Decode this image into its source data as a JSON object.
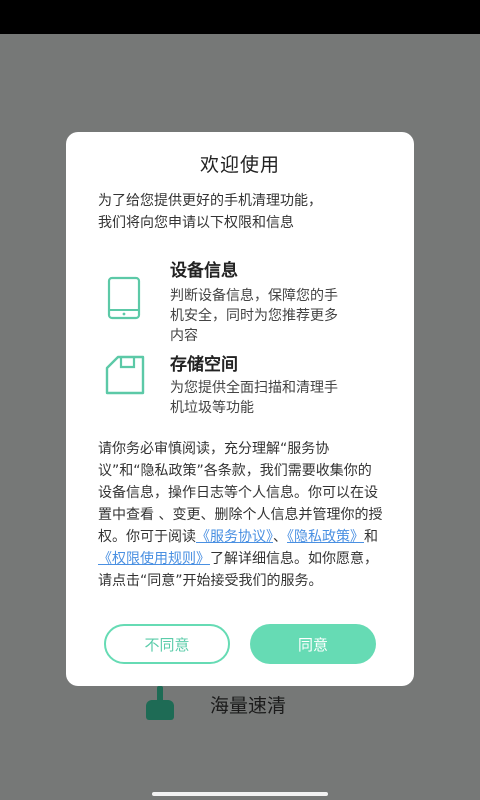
{
  "background_app": {
    "title": "海量速清"
  },
  "dialog": {
    "title": "欢迎使用",
    "intro_lines": [
      "为了给您提供更好的手机清理功能，",
      "我们将向您申请以下权限和信息"
    ],
    "permissions": [
      {
        "icon": "tablet-device-icon",
        "title": "设备信息",
        "desc_lines": [
          "判断设备信息，保障您的手",
          "机安全，同时为您推荐更多",
          "内容"
        ]
      },
      {
        "icon": "sd-card-storage-icon",
        "title": "存储空间",
        "desc_lines": [
          "为您提供全面扫描和清理手",
          "机垃圾等功能"
        ]
      }
    ],
    "notice": {
      "text_1": "请你务必审慎阅读，充分理解“服务协议”和“隐私政策”各条款，我们需要收集你的设备信息，操作日志等个人信息。你可以在设置中查看 、变更、删除个人信息并管理你的授权。你可于阅读",
      "link_service": "《服务协议》",
      "sep_1": "、",
      "link_privacy": "《隐私政策》",
      "sep_2": "和",
      "link_permission_rules": "《权限使用规则》",
      "text_2": "了解详细信息。如你愿意，请点击“同意”开始接受我们的服务。"
    },
    "buttons": {
      "disagree_label": "不同意",
      "agree_label": "同意"
    }
  },
  "colors": {
    "accent": "#66dbb4",
    "link": "#4a90e2",
    "icon_stroke": "#5cc9a7",
    "overlay": "#767877"
  }
}
